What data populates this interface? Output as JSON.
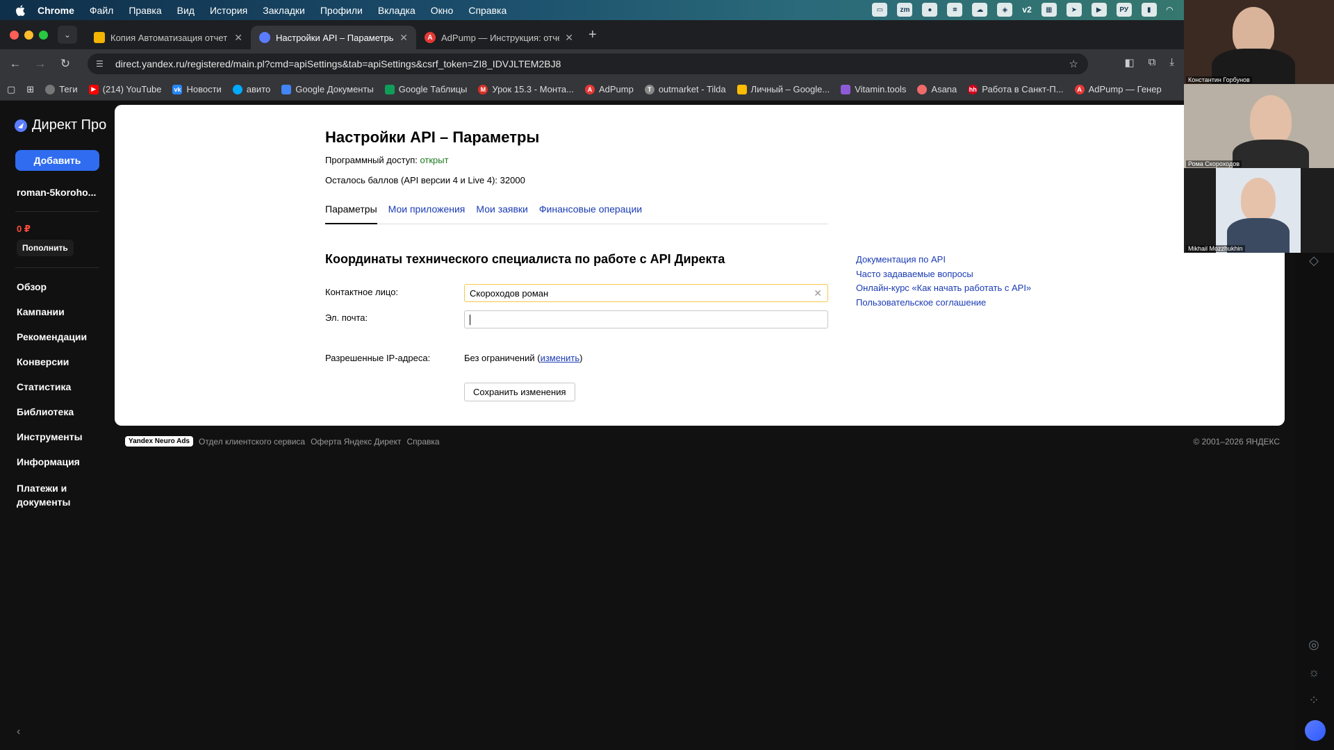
{
  "menubar": {
    "app": "Chrome",
    "items": [
      "Файл",
      "Правка",
      "Вид",
      "История",
      "Закладки",
      "Профили",
      "Вкладка",
      "Окно",
      "Справка"
    ],
    "status_text": "v2"
  },
  "tabs": [
    {
      "title": "Копия Автоматизация отчет",
      "favicon_color": "#f4b400",
      "active": false
    },
    {
      "title": "Настройки API – Параметры",
      "favicon_color": "#5b7cff",
      "active": true
    },
    {
      "title": "AdPump — Инструкция: отче",
      "favicon_color": "#e53935",
      "active": false
    }
  ],
  "url": "direct.yandex.ru/registered/main.pl?cmd=apiSettings&tab=apiSettings&csrf_token=ZI8_IDVJLTEM2BJ8",
  "bookmarks": [
    {
      "label": "Теги",
      "color": "#777777"
    },
    {
      "label": "(214) YouTube",
      "color": "#ff0000"
    },
    {
      "label": "Новости",
      "color": "#2787f5"
    },
    {
      "label": "авито",
      "color": "#00aaff"
    },
    {
      "label": "Google Документы",
      "color": "#4285f4"
    },
    {
      "label": "Google Таблицы",
      "color": "#0f9d58"
    },
    {
      "label": "Урок 15.3 - Монта...",
      "color": "#d93025"
    },
    {
      "label": "AdPump",
      "color": "#e53935"
    },
    {
      "label": "outmarket - Tilda",
      "color": "#888888"
    },
    {
      "label": "Личный – Google...",
      "color": "#fbbc04"
    },
    {
      "label": "Vitamin.tools",
      "color": "#8e5bd6"
    },
    {
      "label": "Asana",
      "color": "#f06a6a"
    },
    {
      "label": "Работа в Санкт-П...",
      "color": "#d6001c"
    },
    {
      "label": "AdPump — Генер",
      "color": "#e53935"
    }
  ],
  "sidebar": {
    "logo": "Директ Про",
    "add_button": "Добавить",
    "account": "roman-5koroho...",
    "balance": "0 ₽",
    "topup": "Пополнить",
    "nav": [
      "Обзор",
      "Кампании",
      "Рекомендации",
      "Конверсии",
      "Статистика",
      "Библиотека",
      "Инструменты",
      "Информация",
      "Платежи и документы"
    ]
  },
  "main": {
    "title": "Настройки API – Параметры",
    "access_label": "Программный доступ:",
    "access_value": "открыт",
    "points_text": "Осталось баллов (API версии 4 и Live 4): 32000",
    "tabs": [
      "Параметры",
      "Мои приложения",
      "Мои заявки",
      "Финансовые операции"
    ],
    "subtitle": "Координаты технического специалиста по работе с API Директа",
    "contact_label": "Контактное лицо:",
    "contact_value": "Скороходов роман",
    "email_label": "Эл. почта:",
    "email_value": "",
    "ip_label": "Разрешенные IP-адреса:",
    "ip_value_prefix": "Без ограничений (",
    "ip_change": "изменить",
    "ip_value_suffix": ")",
    "save_button": "Сохранить изменения",
    "links": [
      "Документация по API",
      "Часто задаваемые вопросы",
      "Онлайн-курс «Как начать работать с API»",
      "Пользовательское соглашение"
    ]
  },
  "footer": {
    "badge": "Yandex Neuro Ads",
    "links": [
      "Отдел клиентского сервиса",
      "Оферта Яндекс Директ",
      "Справка"
    ],
    "copyright": "© 2001–2026 ЯНДЕКС"
  },
  "video": [
    {
      "name": "Константин Горбунов"
    },
    {
      "name": "Рома Скороходов"
    },
    {
      "name": "Mikhail Mozzhukhin"
    }
  ]
}
